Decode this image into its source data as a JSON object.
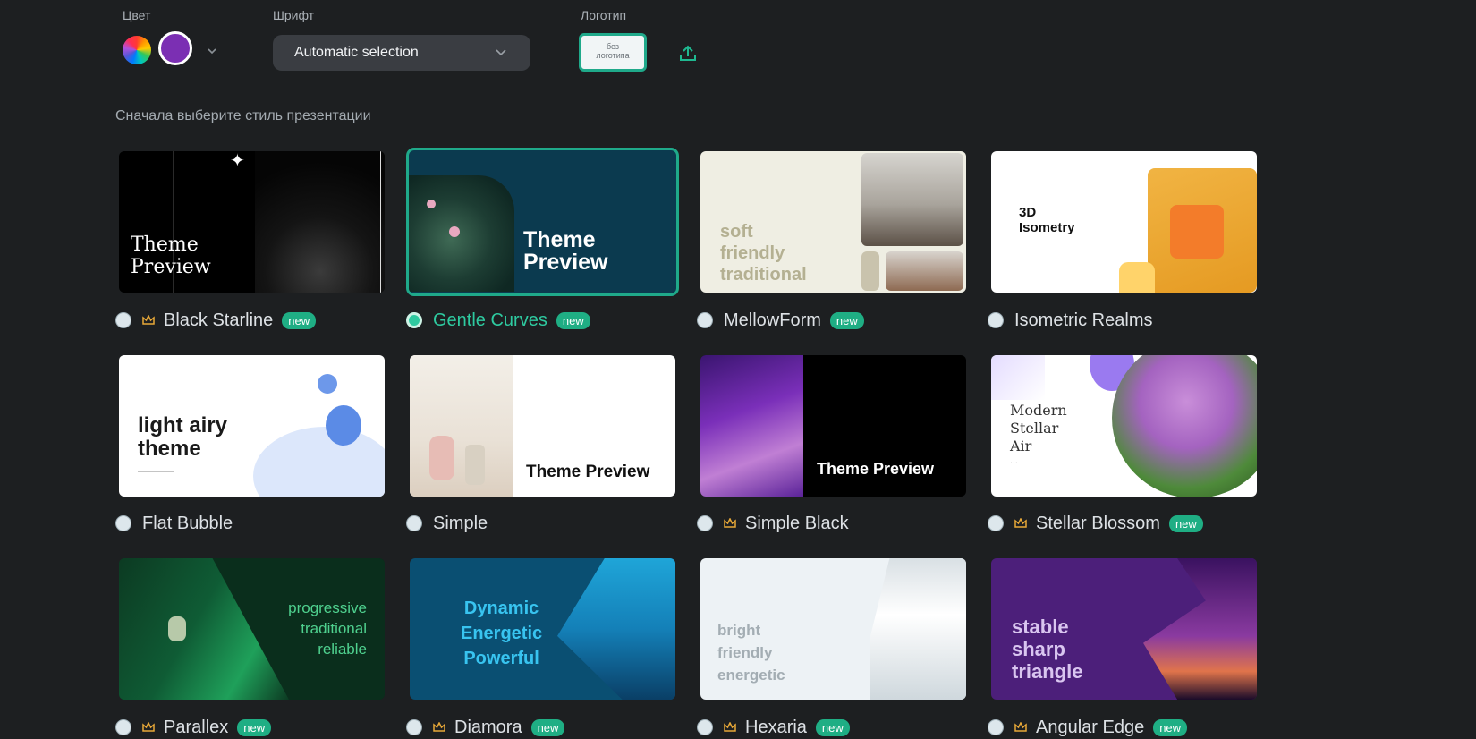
{
  "toolbar": {
    "color_label": "Цвет",
    "font_label": "Шрифт",
    "font_value": "Automatic selection",
    "logo_label": "Логотип",
    "logo_placeholder_line1": "без",
    "logo_placeholder_line2": "логотипа",
    "selected_color": "#7b2fb3"
  },
  "hint": "Сначала выберите стиль презентации",
  "new_badge": "new",
  "themes": [
    {
      "name": "Black Starline",
      "preview": [
        "Theme",
        "Preview"
      ]
    },
    {
      "name": "Gentle Curves",
      "preview": [
        "Theme",
        "Preview"
      ]
    },
    {
      "name": "MellowForm",
      "preview": [
        "soft",
        "friendly",
        "traditional"
      ]
    },
    {
      "name": "Isometric Realms",
      "preview": [
        "3D",
        "Isometry"
      ]
    },
    {
      "name": "Flat Bubble",
      "preview": [
        "light airy",
        "theme"
      ]
    },
    {
      "name": "Simple",
      "preview": [
        "Theme Preview"
      ]
    },
    {
      "name": "Simple Black",
      "preview": [
        "Theme Preview"
      ]
    },
    {
      "name": "Stellar Blossom",
      "preview": [
        "Modern",
        "Stellar",
        "Air",
        "..."
      ]
    },
    {
      "name": "Parallex",
      "preview": [
        "progressive",
        "traditional",
        "reliable"
      ]
    },
    {
      "name": "Diamora",
      "preview": [
        "Dynamic",
        "Energetic",
        "Powerful"
      ]
    },
    {
      "name": "Hexaria",
      "preview": [
        "bright",
        "friendly",
        "energetic"
      ]
    },
    {
      "name": "Angular Edge",
      "preview": [
        "stable",
        "sharp",
        "triangle"
      ]
    }
  ]
}
